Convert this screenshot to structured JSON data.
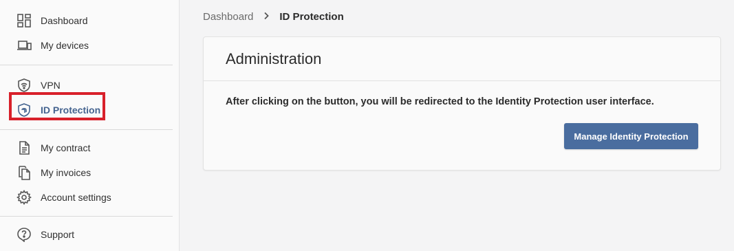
{
  "sidebar": {
    "group1": [
      {
        "label": "Dashboard",
        "icon": "dashboard-icon"
      },
      {
        "label": "My devices",
        "icon": "devices-icon"
      }
    ],
    "group2": [
      {
        "label": "VPN",
        "icon": "vpn-shield-icon"
      },
      {
        "label": "ID Protection",
        "icon": "id-protection-shield-icon",
        "active": true
      }
    ],
    "group3": [
      {
        "label": "My contract",
        "icon": "contract-icon"
      },
      {
        "label": "My invoices",
        "icon": "invoices-icon"
      },
      {
        "label": "Account settings",
        "icon": "gear-icon"
      }
    ],
    "group4": [
      {
        "label": "Support",
        "icon": "support-icon"
      }
    ]
  },
  "breadcrumb": {
    "root": "Dashboard",
    "current": "ID Protection"
  },
  "card": {
    "title": "Administration",
    "text": "After clicking on the button, you will be redirected to the Identity Protection user interface.",
    "button_label": "Manage Identity Protection"
  },
  "colors": {
    "accent": "#4a6d9f",
    "active_text": "#44638f",
    "highlight": "#d8202a"
  }
}
